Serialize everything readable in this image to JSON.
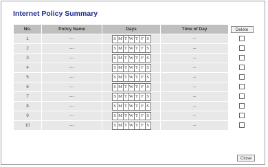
{
  "title": "Internet Policy Summary",
  "columns": {
    "no": "No.",
    "policy_name": "Policy Name",
    "days": "Days",
    "time_of_day": "Time of Day"
  },
  "delete_label": "Delete",
  "close_label": "Close",
  "day_letters": [
    "S",
    "M",
    "T",
    "W",
    "T",
    "F",
    "S"
  ],
  "rows": [
    {
      "no": "1",
      "policy_name": "---",
      "time": "--"
    },
    {
      "no": "2",
      "policy_name": "---",
      "time": "--"
    },
    {
      "no": "3",
      "policy_name": "---",
      "time": "--"
    },
    {
      "no": "4",
      "policy_name": "---",
      "time": "--"
    },
    {
      "no": "5",
      "policy_name": "---",
      "time": "--"
    },
    {
      "no": "6",
      "policy_name": "---",
      "time": "--"
    },
    {
      "no": "7",
      "policy_name": "---",
      "time": "--"
    },
    {
      "no": "8",
      "policy_name": "---",
      "time": "--"
    },
    {
      "no": "9",
      "policy_name": "---",
      "time": "--"
    },
    {
      "no": "10",
      "policy_name": "---",
      "time": "--"
    }
  ]
}
